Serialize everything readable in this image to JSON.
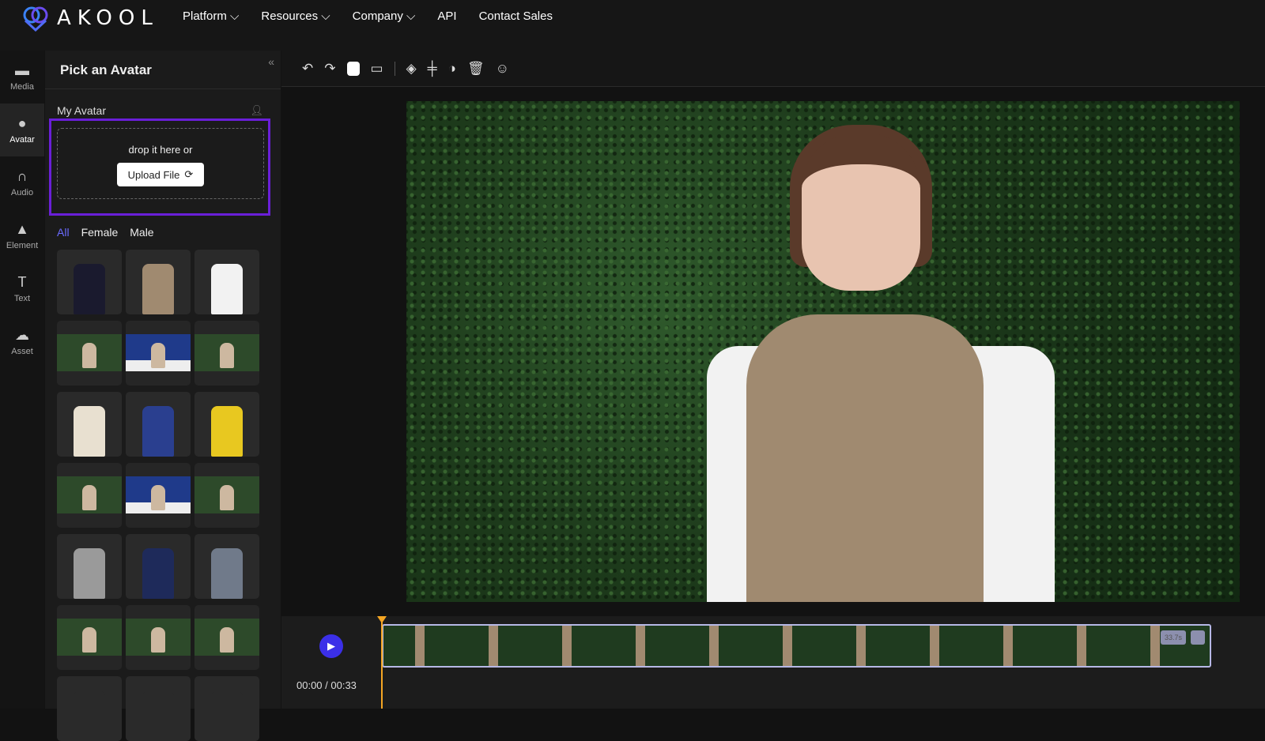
{
  "brand": {
    "name": "AKOOL",
    "accent": "#6a1fd8"
  },
  "nav": {
    "items": [
      {
        "label": "Platform",
        "dropdown": true
      },
      {
        "label": "Resources",
        "dropdown": true
      },
      {
        "label": "Company",
        "dropdown": true
      },
      {
        "label": "API",
        "dropdown": false
      },
      {
        "label": "Contact Sales",
        "dropdown": false
      }
    ]
  },
  "rail": {
    "items": [
      {
        "label": "Media",
        "icon": "folder-icon"
      },
      {
        "label": "Avatar",
        "icon": "person-icon"
      },
      {
        "label": "Audio",
        "icon": "headphones-icon"
      },
      {
        "label": "Element",
        "icon": "shapes-icon"
      },
      {
        "label": "Text",
        "icon": "text-icon"
      },
      {
        "label": "Asset",
        "icon": "cloud-icon"
      }
    ]
  },
  "panel": {
    "title": "Pick an Avatar",
    "my_avatar": "My Avatar",
    "drop_text": "drop it here or",
    "upload_label": "Upload File",
    "filters": [
      "All",
      "Female",
      "Male"
    ]
  },
  "timeline": {
    "time": "00:00 / 00:33",
    "clip_duration": "33.7s"
  }
}
